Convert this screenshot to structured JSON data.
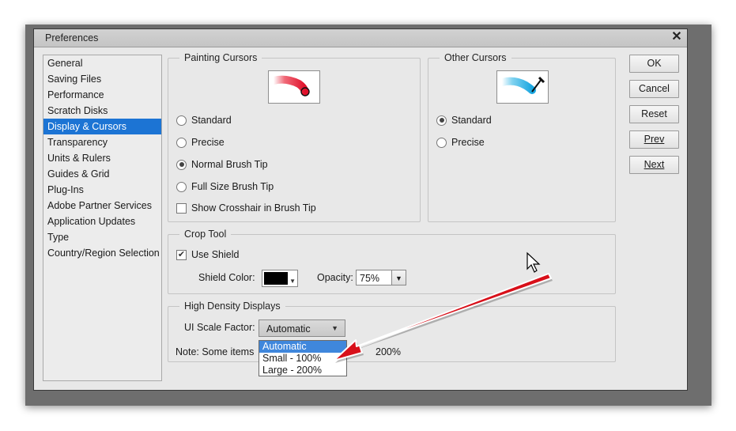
{
  "window": {
    "title": "Preferences",
    "close_glyph": "✕"
  },
  "nav": {
    "items": [
      "General",
      "Saving Files",
      "Performance",
      "Scratch Disks",
      "Display & Cursors",
      "Transparency",
      "Units & Rulers",
      "Guides & Grid",
      "Plug-Ins",
      "Adobe Partner Services",
      "Application Updates",
      "Type",
      "Country/Region Selection"
    ],
    "selected": "Display & Cursors"
  },
  "painting_cursors": {
    "legend": "Painting Cursors",
    "options": {
      "standard": "Standard",
      "precise": "Precise",
      "normal_brush_tip": "Normal Brush Tip",
      "full_size_brush_tip": "Full Size Brush Tip"
    },
    "selected": "Normal Brush Tip",
    "crosshair": {
      "label": "Show Crosshair in Brush Tip",
      "checked": false
    }
  },
  "other_cursors": {
    "legend": "Other Cursors",
    "options": {
      "standard": "Standard",
      "precise": "Precise"
    },
    "selected": "Standard"
  },
  "crop_tool": {
    "legend": "Crop Tool",
    "use_shield": {
      "label": "Use Shield",
      "checked": true
    },
    "shield_color_label": "Shield Color:",
    "shield_color": "#000000",
    "opacity_label": "Opacity:",
    "opacity_value": "75%"
  },
  "high_density": {
    "legend": "High Density Displays",
    "scale_label": "UI Scale Factor:",
    "scale_value": "Automatic",
    "options": [
      "Automatic",
      "Small - 100%",
      "Large - 200%"
    ],
    "note_start": "Note: Some items",
    "note_end": "200%"
  },
  "buttons": {
    "ok": "OK",
    "cancel": "Cancel",
    "reset": "Reset",
    "prev": "Prev",
    "next": "Next"
  },
  "colors": {
    "selection": "#1c74d4",
    "annotation_arrow": "#d8101a"
  }
}
